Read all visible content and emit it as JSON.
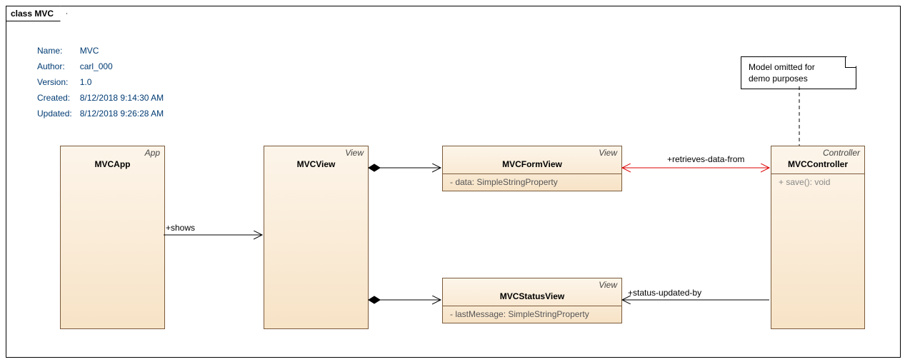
{
  "frame": {
    "title": "class MVC"
  },
  "meta": {
    "name_label": "Name:",
    "name": "MVC",
    "author_label": "Author:",
    "author": "carl_000",
    "version_label": "Version:",
    "version": "1.0",
    "created_label": "Created:",
    "created": "8/12/2018 9:14:30 AM",
    "updated_label": "Updated:",
    "updated": "8/12/2018 9:26:28 AM"
  },
  "note": {
    "line1": "Model omitted for",
    "line2": "demo purposes"
  },
  "classes": {
    "app": {
      "stereo": "App",
      "name": "MVCApp"
    },
    "view": {
      "stereo": "View",
      "name": "MVCView"
    },
    "formview": {
      "stereo": "View",
      "name": "MVCFormView",
      "member": "-   data: SimpleStringProperty"
    },
    "statusview": {
      "stereo": "View",
      "name": "MVCStatusView",
      "member": "-   lastMessage: SimpleStringProperty"
    },
    "controller": {
      "stereo": "Controller",
      "name": "MVCController",
      "member": "+   save(): void"
    }
  },
  "assoc": {
    "shows": "+shows",
    "retrieves": "+retrieves-data-from",
    "status": "+status-updated-by"
  },
  "chart_data": {
    "type": "uml-class-diagram",
    "frame": "MVC",
    "classes": [
      {
        "id": "MVCApp",
        "stereotype": "App"
      },
      {
        "id": "MVCView",
        "stereotype": "View"
      },
      {
        "id": "MVCFormView",
        "stereotype": "View",
        "attributes": [
          "- data: SimpleStringProperty"
        ]
      },
      {
        "id": "MVCStatusView",
        "stereotype": "View",
        "attributes": [
          "- lastMessage: SimpleStringProperty"
        ]
      },
      {
        "id": "MVCController",
        "stereotype": "Controller",
        "operations": [
          "+ save(): void"
        ]
      }
    ],
    "notes": [
      {
        "text": "Model omitted for demo purposes",
        "attachedTo": "MVCController"
      }
    ],
    "relations": [
      {
        "from": "MVCApp",
        "to": "MVCView",
        "type": "association-directed",
        "label": "+shows"
      },
      {
        "from": "MVCView",
        "to": "MVCFormView",
        "type": "composition-directed"
      },
      {
        "from": "MVCView",
        "to": "MVCStatusView",
        "type": "composition-directed"
      },
      {
        "from": "MVCFormView",
        "to": "MVCController",
        "type": "association-bidirectional",
        "label": "+retrieves-data-from",
        "highlighted": true
      },
      {
        "from": "MVCController",
        "to": "MVCStatusView",
        "type": "association-directed",
        "label": "+status-updated-by"
      }
    ]
  }
}
